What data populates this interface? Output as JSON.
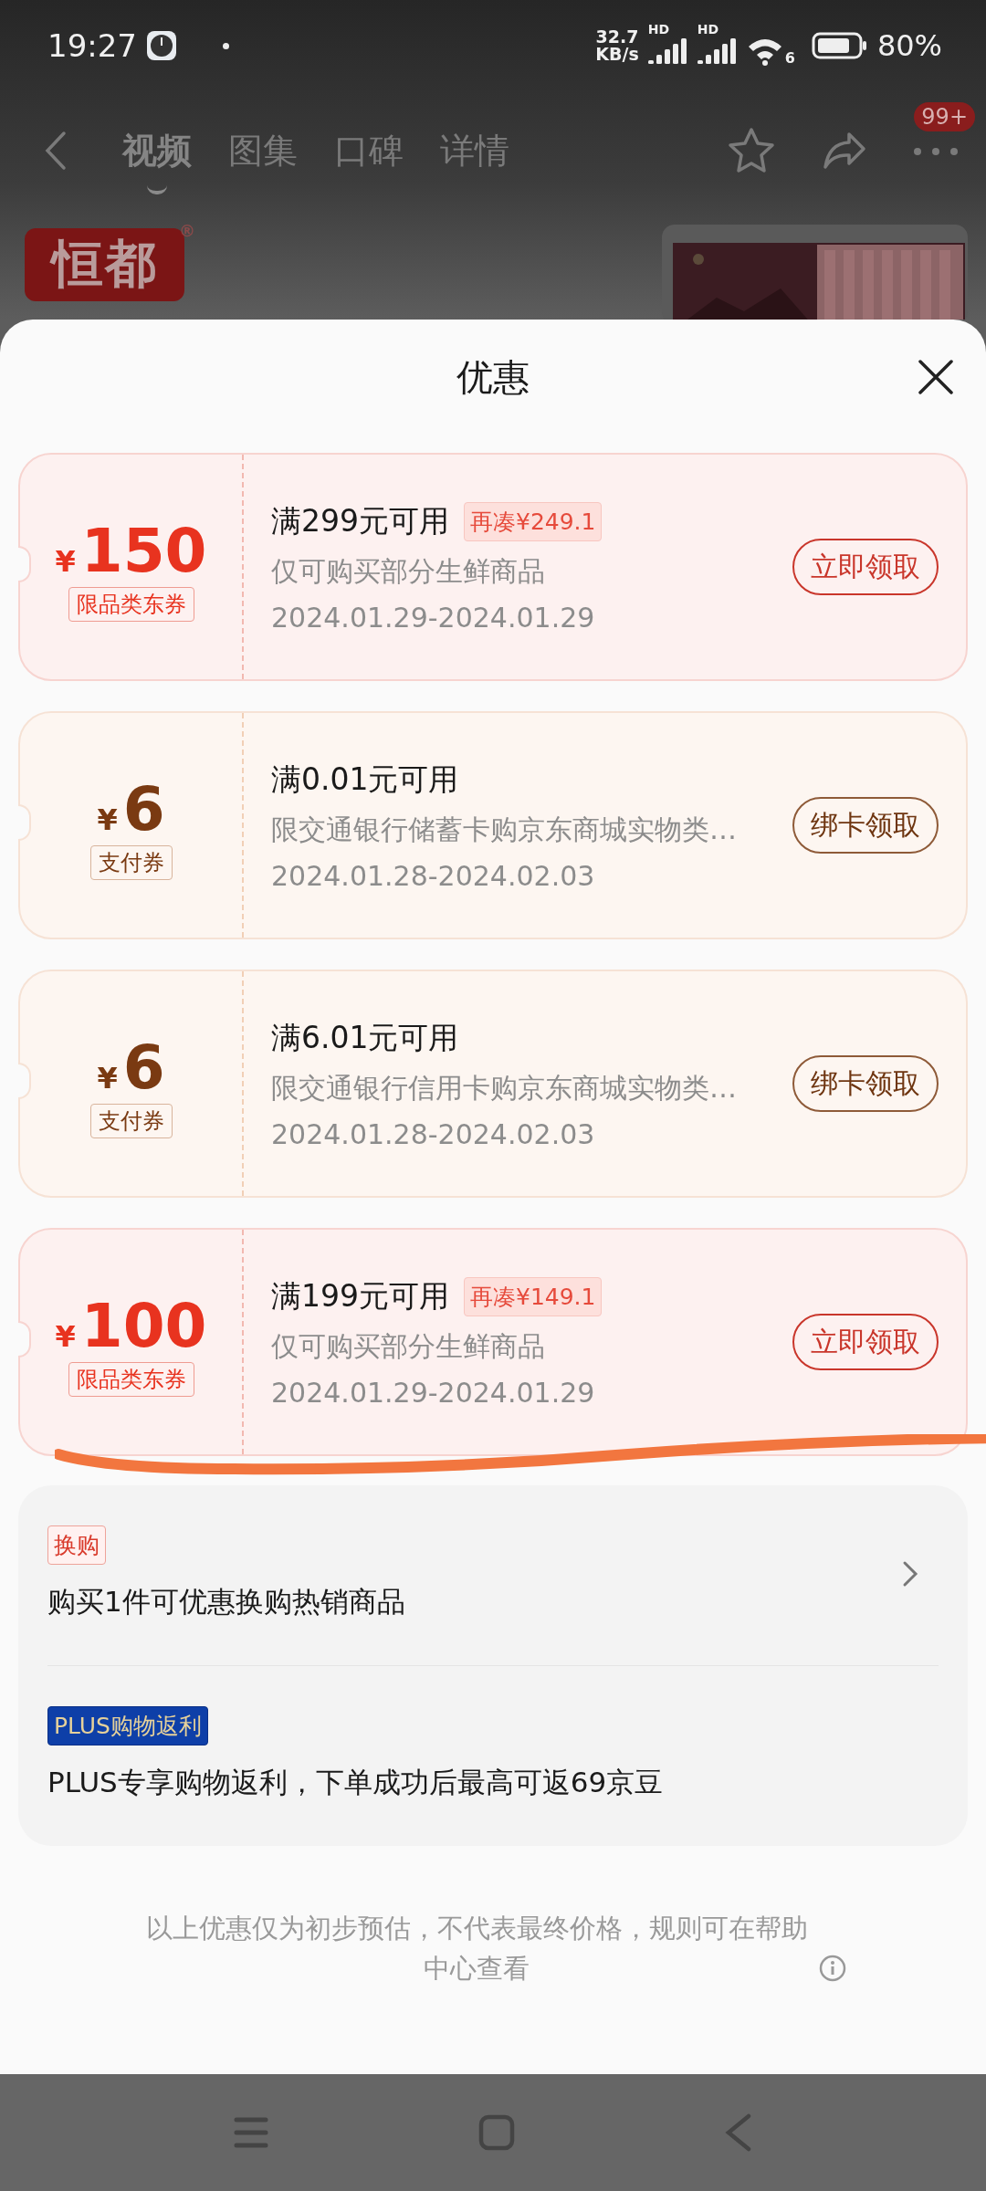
{
  "status_bar": {
    "time": "19:27",
    "net_speed_value": "32.7",
    "net_speed_unit": "KB/s",
    "signal_labels": [
      "HD",
      "HD"
    ],
    "wifi_label": "6",
    "battery": "80%"
  },
  "nav": {
    "tabs": [
      {
        "label": "视频",
        "selected": true
      },
      {
        "label": "图集",
        "selected": false
      },
      {
        "label": "口碑",
        "selected": false
      },
      {
        "label": "详情",
        "selected": false
      }
    ],
    "badge": "99+"
  },
  "product": {
    "brand_logo": "恒都",
    "registered_mark": "®"
  },
  "sheet": {
    "title": "优惠",
    "coupons": [
      {
        "kind": "jd",
        "currency": "¥",
        "amount": "150",
        "type_label": "限品类东券",
        "condition": "满299元可用",
        "extra": "再凑¥249.1",
        "description": "仅可购买部分生鲜商品",
        "period": "2024.01.29-2024.01.29",
        "action": "立即领取"
      },
      {
        "kind": "pay",
        "currency": "¥",
        "amount": "6",
        "type_label": "支付券",
        "condition": "满0.01元可用",
        "description": "限交通银行储蓄卡购京东商城实物类…",
        "period": "2024.01.28-2024.02.03",
        "action": "绑卡领取"
      },
      {
        "kind": "pay",
        "currency": "¥",
        "amount": "6",
        "type_label": "支付券",
        "condition": "满6.01元可用",
        "description": "限交通银行信用卡购京东商城实物类…",
        "period": "2024.01.28-2024.02.03",
        "action": "绑卡领取"
      },
      {
        "kind": "jd",
        "currency": "¥",
        "amount": "100",
        "type_label": "限品类东券",
        "condition": "满199元可用",
        "extra": "再凑¥149.1",
        "description": "仅可购买部分生鲜商品",
        "period": "2024.01.29-2024.01.29",
        "action": "立即领取"
      }
    ],
    "promotions": [
      {
        "kind": "swap",
        "tag": "换购",
        "text": "购买1件可优惠换购热销商品",
        "has_arrow": true
      },
      {
        "kind": "plus",
        "tag": "PLUS购物返利",
        "text": "PLUS专享购物返利，下单成功后最高可返69京豆",
        "has_arrow": false
      }
    ],
    "note": "以上优惠仅为初步预估，不代表最终价格，规则可在帮助中心查看"
  }
}
